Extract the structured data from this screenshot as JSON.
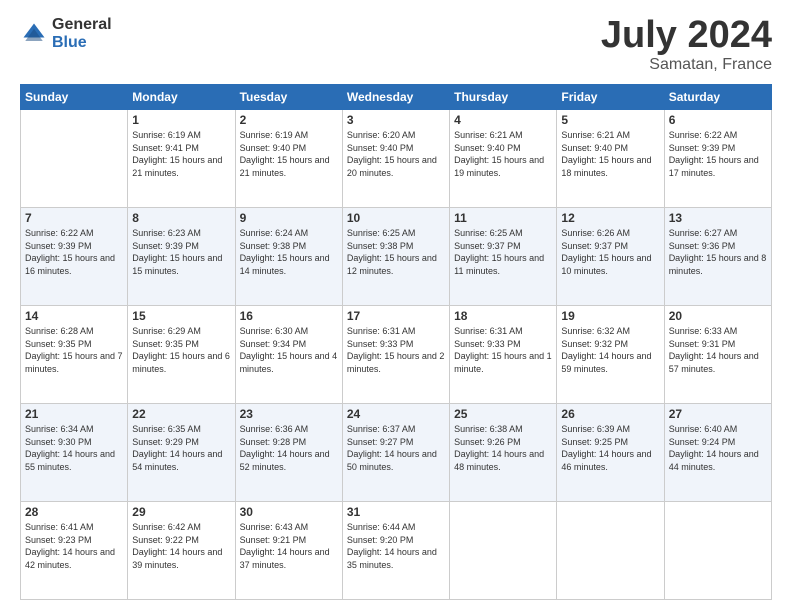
{
  "logo": {
    "general": "General",
    "blue": "Blue"
  },
  "title": {
    "month": "July 2024",
    "location": "Samatan, France"
  },
  "weekdays": [
    "Sunday",
    "Monday",
    "Tuesday",
    "Wednesday",
    "Thursday",
    "Friday",
    "Saturday"
  ],
  "weeks": [
    [
      {
        "day": "",
        "sunrise": "",
        "sunset": "",
        "daylight": ""
      },
      {
        "day": "1",
        "sunrise": "Sunrise: 6:19 AM",
        "sunset": "Sunset: 9:41 PM",
        "daylight": "Daylight: 15 hours and 21 minutes."
      },
      {
        "day": "2",
        "sunrise": "Sunrise: 6:19 AM",
        "sunset": "Sunset: 9:40 PM",
        "daylight": "Daylight: 15 hours and 21 minutes."
      },
      {
        "day": "3",
        "sunrise": "Sunrise: 6:20 AM",
        "sunset": "Sunset: 9:40 PM",
        "daylight": "Daylight: 15 hours and 20 minutes."
      },
      {
        "day": "4",
        "sunrise": "Sunrise: 6:21 AM",
        "sunset": "Sunset: 9:40 PM",
        "daylight": "Daylight: 15 hours and 19 minutes."
      },
      {
        "day": "5",
        "sunrise": "Sunrise: 6:21 AM",
        "sunset": "Sunset: 9:40 PM",
        "daylight": "Daylight: 15 hours and 18 minutes."
      },
      {
        "day": "6",
        "sunrise": "Sunrise: 6:22 AM",
        "sunset": "Sunset: 9:39 PM",
        "daylight": "Daylight: 15 hours and 17 minutes."
      }
    ],
    [
      {
        "day": "7",
        "sunrise": "Sunrise: 6:22 AM",
        "sunset": "Sunset: 9:39 PM",
        "daylight": "Daylight: 15 hours and 16 minutes."
      },
      {
        "day": "8",
        "sunrise": "Sunrise: 6:23 AM",
        "sunset": "Sunset: 9:39 PM",
        "daylight": "Daylight: 15 hours and 15 minutes."
      },
      {
        "day": "9",
        "sunrise": "Sunrise: 6:24 AM",
        "sunset": "Sunset: 9:38 PM",
        "daylight": "Daylight: 15 hours and 14 minutes."
      },
      {
        "day": "10",
        "sunrise": "Sunrise: 6:25 AM",
        "sunset": "Sunset: 9:38 PM",
        "daylight": "Daylight: 15 hours and 12 minutes."
      },
      {
        "day": "11",
        "sunrise": "Sunrise: 6:25 AM",
        "sunset": "Sunset: 9:37 PM",
        "daylight": "Daylight: 15 hours and 11 minutes."
      },
      {
        "day": "12",
        "sunrise": "Sunrise: 6:26 AM",
        "sunset": "Sunset: 9:37 PM",
        "daylight": "Daylight: 15 hours and 10 minutes."
      },
      {
        "day": "13",
        "sunrise": "Sunrise: 6:27 AM",
        "sunset": "Sunset: 9:36 PM",
        "daylight": "Daylight: 15 hours and 8 minutes."
      }
    ],
    [
      {
        "day": "14",
        "sunrise": "Sunrise: 6:28 AM",
        "sunset": "Sunset: 9:35 PM",
        "daylight": "Daylight: 15 hours and 7 minutes."
      },
      {
        "day": "15",
        "sunrise": "Sunrise: 6:29 AM",
        "sunset": "Sunset: 9:35 PM",
        "daylight": "Daylight: 15 hours and 6 minutes."
      },
      {
        "day": "16",
        "sunrise": "Sunrise: 6:30 AM",
        "sunset": "Sunset: 9:34 PM",
        "daylight": "Daylight: 15 hours and 4 minutes."
      },
      {
        "day": "17",
        "sunrise": "Sunrise: 6:31 AM",
        "sunset": "Sunset: 9:33 PM",
        "daylight": "Daylight: 15 hours and 2 minutes."
      },
      {
        "day": "18",
        "sunrise": "Sunrise: 6:31 AM",
        "sunset": "Sunset: 9:33 PM",
        "daylight": "Daylight: 15 hours and 1 minute."
      },
      {
        "day": "19",
        "sunrise": "Sunrise: 6:32 AM",
        "sunset": "Sunset: 9:32 PM",
        "daylight": "Daylight: 14 hours and 59 minutes."
      },
      {
        "day": "20",
        "sunrise": "Sunrise: 6:33 AM",
        "sunset": "Sunset: 9:31 PM",
        "daylight": "Daylight: 14 hours and 57 minutes."
      }
    ],
    [
      {
        "day": "21",
        "sunrise": "Sunrise: 6:34 AM",
        "sunset": "Sunset: 9:30 PM",
        "daylight": "Daylight: 14 hours and 55 minutes."
      },
      {
        "day": "22",
        "sunrise": "Sunrise: 6:35 AM",
        "sunset": "Sunset: 9:29 PM",
        "daylight": "Daylight: 14 hours and 54 minutes."
      },
      {
        "day": "23",
        "sunrise": "Sunrise: 6:36 AM",
        "sunset": "Sunset: 9:28 PM",
        "daylight": "Daylight: 14 hours and 52 minutes."
      },
      {
        "day": "24",
        "sunrise": "Sunrise: 6:37 AM",
        "sunset": "Sunset: 9:27 PM",
        "daylight": "Daylight: 14 hours and 50 minutes."
      },
      {
        "day": "25",
        "sunrise": "Sunrise: 6:38 AM",
        "sunset": "Sunset: 9:26 PM",
        "daylight": "Daylight: 14 hours and 48 minutes."
      },
      {
        "day": "26",
        "sunrise": "Sunrise: 6:39 AM",
        "sunset": "Sunset: 9:25 PM",
        "daylight": "Daylight: 14 hours and 46 minutes."
      },
      {
        "day": "27",
        "sunrise": "Sunrise: 6:40 AM",
        "sunset": "Sunset: 9:24 PM",
        "daylight": "Daylight: 14 hours and 44 minutes."
      }
    ],
    [
      {
        "day": "28",
        "sunrise": "Sunrise: 6:41 AM",
        "sunset": "Sunset: 9:23 PM",
        "daylight": "Daylight: 14 hours and 42 minutes."
      },
      {
        "day": "29",
        "sunrise": "Sunrise: 6:42 AM",
        "sunset": "Sunset: 9:22 PM",
        "daylight": "Daylight: 14 hours and 39 minutes."
      },
      {
        "day": "30",
        "sunrise": "Sunrise: 6:43 AM",
        "sunset": "Sunset: 9:21 PM",
        "daylight": "Daylight: 14 hours and 37 minutes."
      },
      {
        "day": "31",
        "sunrise": "Sunrise: 6:44 AM",
        "sunset": "Sunset: 9:20 PM",
        "daylight": "Daylight: 14 hours and 35 minutes."
      },
      {
        "day": "",
        "sunrise": "",
        "sunset": "",
        "daylight": ""
      },
      {
        "day": "",
        "sunrise": "",
        "sunset": "",
        "daylight": ""
      },
      {
        "day": "",
        "sunrise": "",
        "sunset": "",
        "daylight": ""
      }
    ]
  ]
}
